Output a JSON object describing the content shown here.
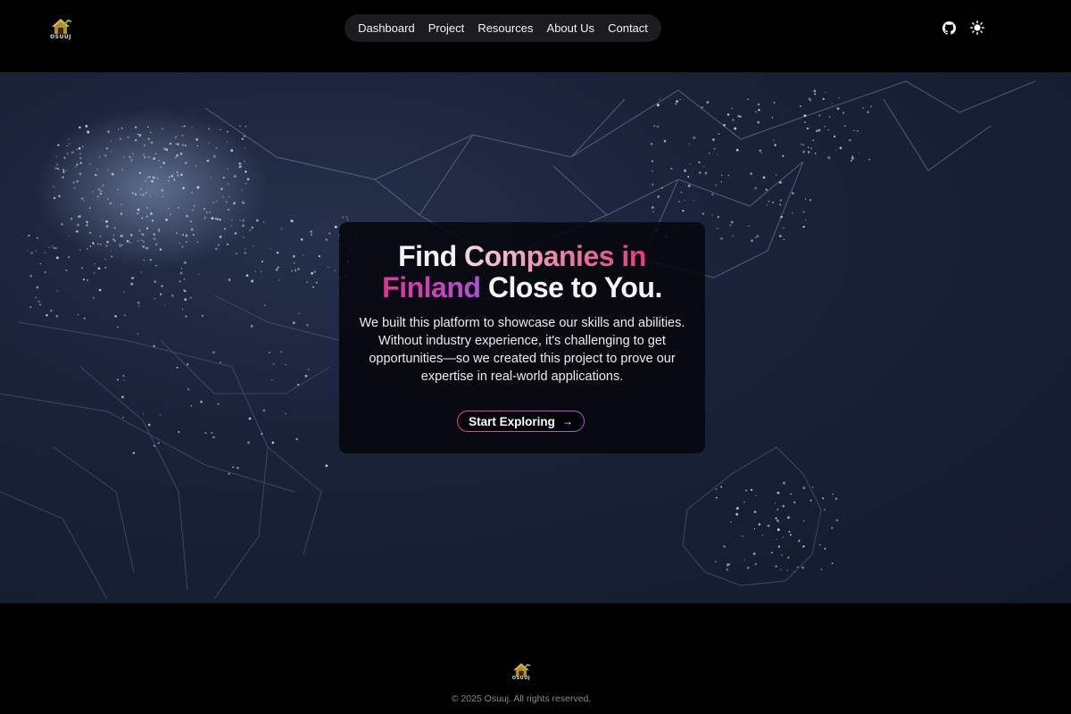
{
  "brand": {
    "name": "OSUUJ"
  },
  "nav": {
    "items": [
      {
        "label": "Dashboard"
      },
      {
        "label": "Project"
      },
      {
        "label": "Resources"
      },
      {
        "label": "About Us"
      },
      {
        "label": "Contact"
      }
    ]
  },
  "header_icons": {
    "github": "github-icon",
    "theme": "sun-icon"
  },
  "hero": {
    "headline": {
      "part1": "Find ",
      "part2": "Companies in",
      "part3": "Finland",
      "part4": " Close to You."
    },
    "description": "We built this platform to showcase our skills and abilities. Without industry experience, it's challenging to get opportunities—so we created this project to prove our expertise in real-world applications.",
    "cta_label": "Start Exploring",
    "cta_icon": "→"
  },
  "footer": {
    "copyright": "© 2025 Osuuj. All rights reserved."
  },
  "colors": {
    "background": "#000000",
    "accent_pink": "#e43a7a",
    "accent_purple": "#a259d9",
    "nav_bg": "#1c1c1f"
  }
}
